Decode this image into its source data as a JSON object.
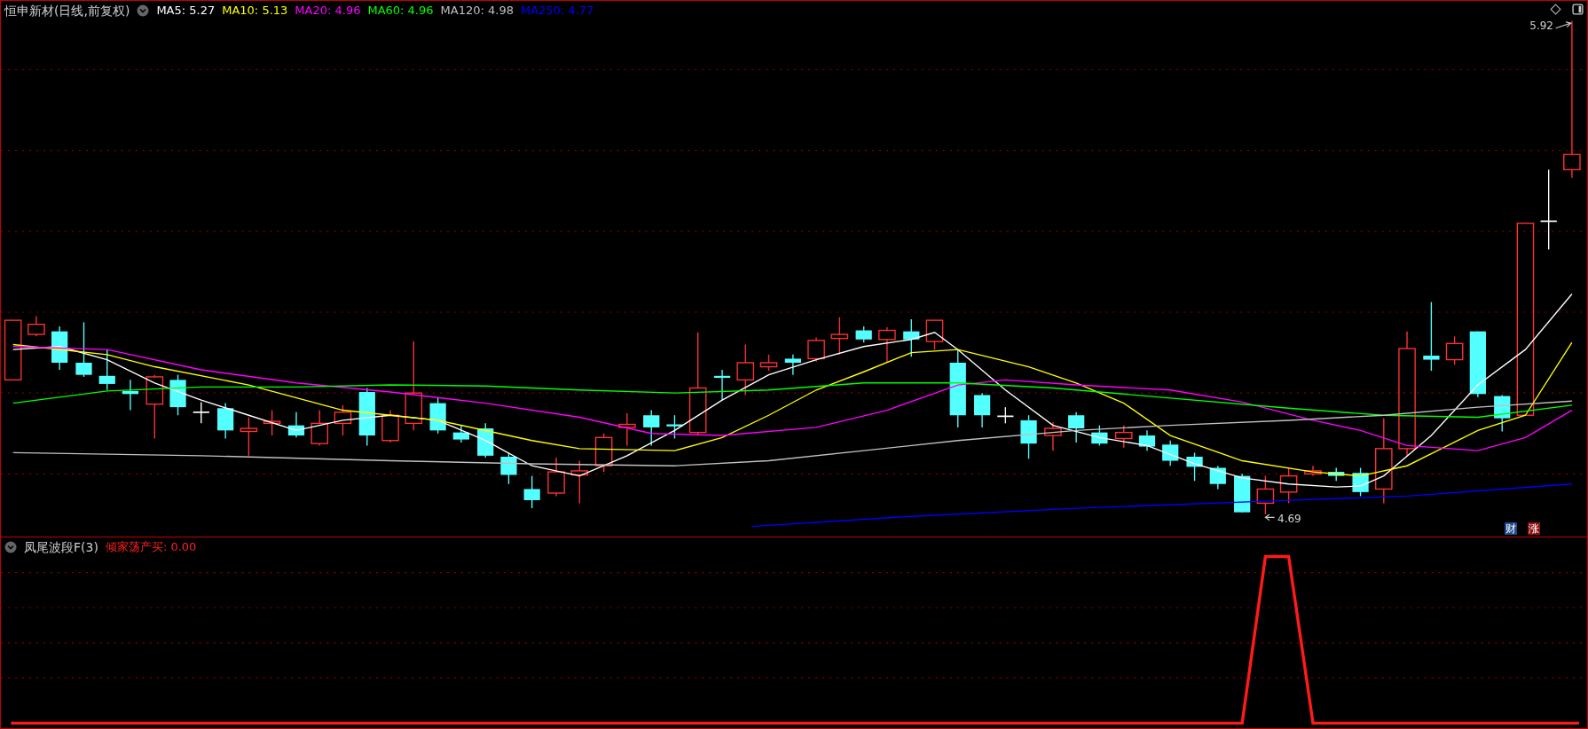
{
  "main_panel": {
    "title": "恒申新材(日线,前复权)",
    "moving_averages": [
      {
        "label": "MA5: 5.27",
        "color": "#ffffff"
      },
      {
        "label": "MA10: 5.13",
        "color": "#ffff00"
      },
      {
        "label": "MA20: 4.96",
        "color": "#ff00ff"
      },
      {
        "label": "MA60: 4.96",
        "color": "#00ff00"
      },
      {
        "label": "MA120: 4.98",
        "color": "#c0c0c0"
      },
      {
        "label": "MA250: 4.77",
        "color": "#0000ff"
      }
    ],
    "high_label": "5.92",
    "low_label": "4.69",
    "badges": [
      {
        "text": "财",
        "kind": "finance"
      },
      {
        "text": "涨",
        "kind": "limit"
      }
    ]
  },
  "indicator_panel": {
    "title": "凤尾波段F(3)",
    "reading": "倾家荡产买: 0.00"
  }
}
